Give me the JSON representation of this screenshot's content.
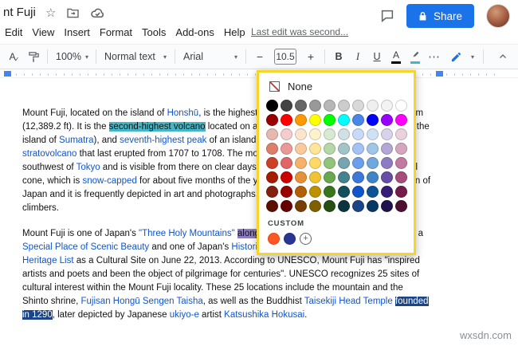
{
  "titlebar": {
    "title": "nt Fuji",
    "share_label": "Share"
  },
  "menubar": {
    "items": [
      "Edit",
      "View",
      "Insert",
      "Format",
      "Tools",
      "Add-ons",
      "Help"
    ],
    "last_edit": "Last edit was second..."
  },
  "toolbar": {
    "zoom": "100%",
    "style": "Normal text",
    "font": "Arial",
    "font_size": "10.5",
    "bold": "B",
    "italic": "I",
    "underline": "U",
    "text_color": "A"
  },
  "icons": {
    "star": "☆",
    "dropdown_arrow": "▾",
    "minus": "−",
    "plus": "+",
    "more": "⋯",
    "spellcheck_a": "A",
    "spellcheck_check": "✓",
    "add_custom_plus": "+"
  },
  "color_picker": {
    "none_label": "None",
    "custom_label": "CUSTOM",
    "rows": [
      [
        "#000000",
        "#434343",
        "#666666",
        "#999999",
        "#b7b7b7",
        "#cccccc",
        "#d9d9d9",
        "#efefef",
        "#f3f3f3",
        "#ffffff"
      ],
      [
        "#980000",
        "#ff0000",
        "#ff9900",
        "#ffff00",
        "#00ff00",
        "#00ffff",
        "#4a86e8",
        "#0000ff",
        "#9900ff",
        "#ff00ff"
      ],
      [
        "#e6b8af",
        "#f4cccc",
        "#fce5cd",
        "#fff2cc",
        "#d9ead3",
        "#d0e0e3",
        "#c9daf8",
        "#cfe2f3",
        "#d9d2e9",
        "#ead1dc"
      ],
      [
        "#dd7e6b",
        "#ea9999",
        "#f9cb9c",
        "#ffe599",
        "#b6d7a8",
        "#a2c4c9",
        "#a4c2f4",
        "#9fc5e8",
        "#b4a7d6",
        "#d5a6bd"
      ],
      [
        "#cc4125",
        "#e06666",
        "#f6b26b",
        "#ffd966",
        "#93c47c",
        "#76a5af",
        "#6d9eeb",
        "#6fa8dc",
        "#8e7cc3",
        "#c27ba0"
      ],
      [
        "#a61c00",
        "#cc0000",
        "#e69138",
        "#f1c232",
        "#6aa84f",
        "#45818e",
        "#3c78d8",
        "#3d85c6",
        "#674ea7",
        "#a64d79"
      ],
      [
        "#85200c",
        "#990000",
        "#b45f06",
        "#bf9000",
        "#38761d",
        "#134f5c",
        "#1155cc",
        "#0b5394",
        "#351c75",
        "#741b47"
      ],
      [
        "#5b0f00",
        "#660000",
        "#783f04",
        "#7f6000",
        "#274e13",
        "#0c343d",
        "#1c4587",
        "#073763",
        "#20124d",
        "#4c1130"
      ]
    ],
    "custom_colors": [
      "#ff5722",
      "#283593"
    ]
  },
  "document": {
    "paragraphs": [
      {
        "lines": [
          [
            {
              "t": "Mount Fuji, located on the island of "
            },
            {
              "t": "Honshū",
              "s": "link"
            },
            {
              "t": ", is the highest mountain in Japan, standing 3,776.24 m"
            }
          ],
          [
            {
              "t": "(12,389.2 ft). It is the "
            },
            {
              "t": "second-highest volcano",
              "s": "hl-teal"
            },
            {
              "t": " located on an island in Asia (after Mount Kerinci on the"
            }
          ],
          [
            {
              "t": "island of "
            },
            {
              "t": "Sumatra",
              "s": "link"
            },
            {
              "t": "), and "
            },
            {
              "t": "seventh-highest peak",
              "s": "link"
            },
            {
              "t": " of an island on Earth. Mount Fuji is an active"
            }
          ],
          [
            {
              "t": "stratovolcano",
              "s": "link"
            },
            {
              "t": " that last erupted from 1707 to 1708. The mountain stands about 100 km (62 mi)"
            }
          ],
          [
            {
              "t": "southwest of "
            },
            {
              "t": "Tokyo",
              "s": "link"
            },
            {
              "t": " and is visible from there on clear days. Mount Fuji's exceptionally symmetrical"
            }
          ],
          [
            {
              "t": "cone, which is "
            },
            {
              "t": "snow-capped",
              "s": "link"
            },
            {
              "t": " for about five months of the year, is commonly used as a cultural icon of"
            }
          ],
          [
            {
              "t": "Japan and it is frequently depicted in art and photographs, as well as visited by sightseers and"
            }
          ],
          [
            {
              "t": "climbers."
            }
          ]
        ]
      },
      {
        "lines": [
          [
            {
              "t": "Mount Fuji is one of Japan's "
            },
            {
              "t": "\"Three Holy Mountains\"",
              "s": "link"
            },
            {
              "t": " "
            },
            {
              "t": "along",
              "s": "hl-purple"
            },
            {
              "t": " with Mount Tate and Mount Haku. It is a"
            }
          ],
          [
            {
              "t": "Special Place of Scenic Beauty",
              "s": "link"
            },
            {
              "t": " and one of Japan's "
            },
            {
              "t": "Historic Sites",
              "s": "link"
            },
            {
              "t": ". It was added to the "
            },
            {
              "t": "World",
              "s": "link"
            }
          ],
          [
            {
              "t": "Heritage List",
              "s": "link"
            },
            {
              "t": " as a Cultural Site on June 22, 2013. According to UNESCO, Mount Fuji has \"inspired"
            }
          ],
          [
            {
              "t": "artists and poets and been the object of pilgrimage for centuries\". UNESCO recognizes 25 sites of"
            }
          ],
          [
            {
              "t": "cultural interest within the Mount Fuji locality. These 25 locations include the mountain and the"
            }
          ],
          [
            {
              "t": "Shinto shrine, "
            },
            {
              "t": "Fujisan Hongū Sengen Taisha",
              "s": "link"
            },
            {
              "t": ", as well as the Buddhist "
            },
            {
              "t": "Taisekiji Head Temple",
              "s": "link"
            },
            {
              "t": " "
            },
            {
              "t": "founded",
              "s": "hl-navy"
            }
          ],
          [
            {
              "t": "in 1290",
              "s": "hl-navy"
            },
            {
              "t": ", later depicted by Japanese "
            },
            {
              "t": "ukiyo-e",
              "s": "link"
            },
            {
              "t": " artist "
            },
            {
              "t": "Katsushika Hokusai",
              "s": "link"
            },
            {
              "t": "."
            }
          ]
        ]
      }
    ]
  },
  "watermark": "wxsdn.com",
  "colors": {
    "accent": "#1a73e8",
    "link": "#1155cc",
    "hl_teal": "#45b6c6",
    "hl_purple": "#8e7cc3",
    "hl_navy": "#1c4587",
    "annotation": "#f7d427"
  }
}
